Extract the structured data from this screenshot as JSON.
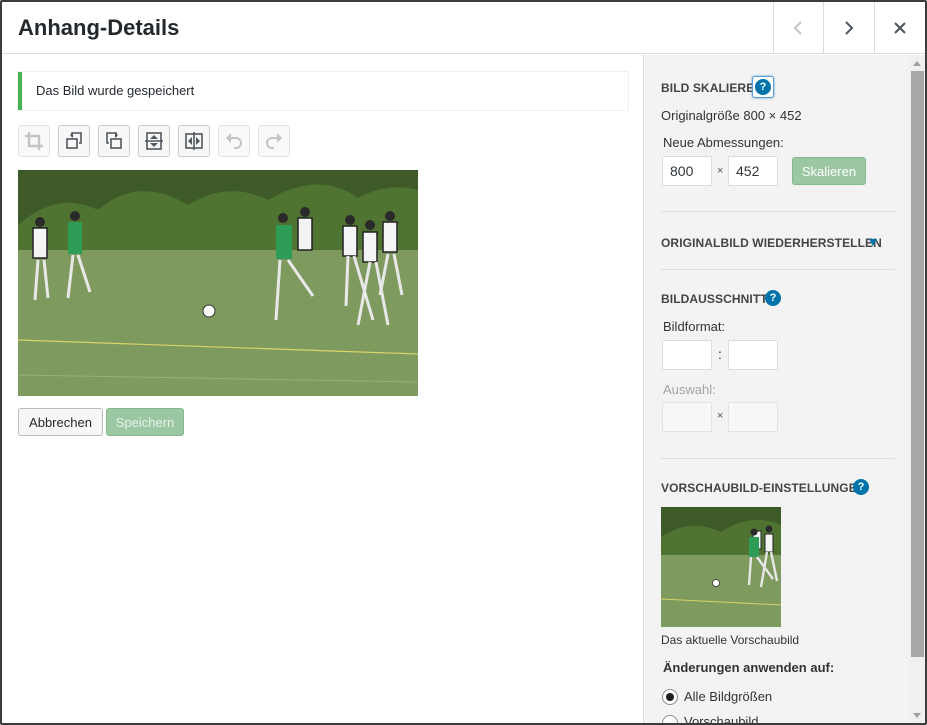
{
  "header": {
    "title": "Anhang-Details",
    "prev_icon": "chevron-left-icon",
    "next_icon": "chevron-right-icon",
    "close_icon": "close-icon"
  },
  "notice": {
    "text": "Das Bild wurde gespeichert",
    "color": "#46b450"
  },
  "toolbar": {
    "tools": [
      {
        "icon": "crop-icon",
        "enabled": false
      },
      {
        "icon": "rotate-left-icon",
        "enabled": true
      },
      {
        "icon": "rotate-right-icon",
        "enabled": true
      },
      {
        "icon": "flip-vertical-icon",
        "enabled": true
      },
      {
        "icon": "flip-horizontal-icon",
        "enabled": true
      },
      {
        "icon": "undo-icon",
        "enabled": false
      },
      {
        "icon": "redo-icon",
        "enabled": false
      }
    ]
  },
  "actions": {
    "cancel_label": "Abbrechen",
    "save_label": "Speichern"
  },
  "scale": {
    "title": "BILD SKALIEREN",
    "original_size": "Originalgröße 800 × 452",
    "new_dimensions_label": "Neue Abmessungen:",
    "width": "800",
    "height": "452",
    "times": "×",
    "button_label": "Skalieren"
  },
  "restore": {
    "title": "ORIGINALBILD WIEDERHERSTELLEN"
  },
  "crop": {
    "title": "BILDAUSSCHNITT",
    "ratio_label": "Bildformat:",
    "ratio_w": "",
    "ratio_h": "",
    "colon": ":",
    "selection_label": "Auswahl:",
    "sel_w": "",
    "sel_h": "",
    "times": "×"
  },
  "thumbnail": {
    "title": "VORSCHAUBILD-EINSTELLUNGEN",
    "caption": "Das aktuelle Vorschaubild",
    "apply_label": "Änderungen anwenden auf:",
    "options": [
      {
        "label": "Alle Bildgrößen",
        "checked": true
      },
      {
        "label": "Vorschaubild",
        "checked": false
      }
    ]
  },
  "help_icon": "help-icon",
  "colors": {
    "accent": "#0073aa",
    "primary_disabled": "#9bc7a3",
    "sidebar_bg": "#f3f3f3"
  }
}
